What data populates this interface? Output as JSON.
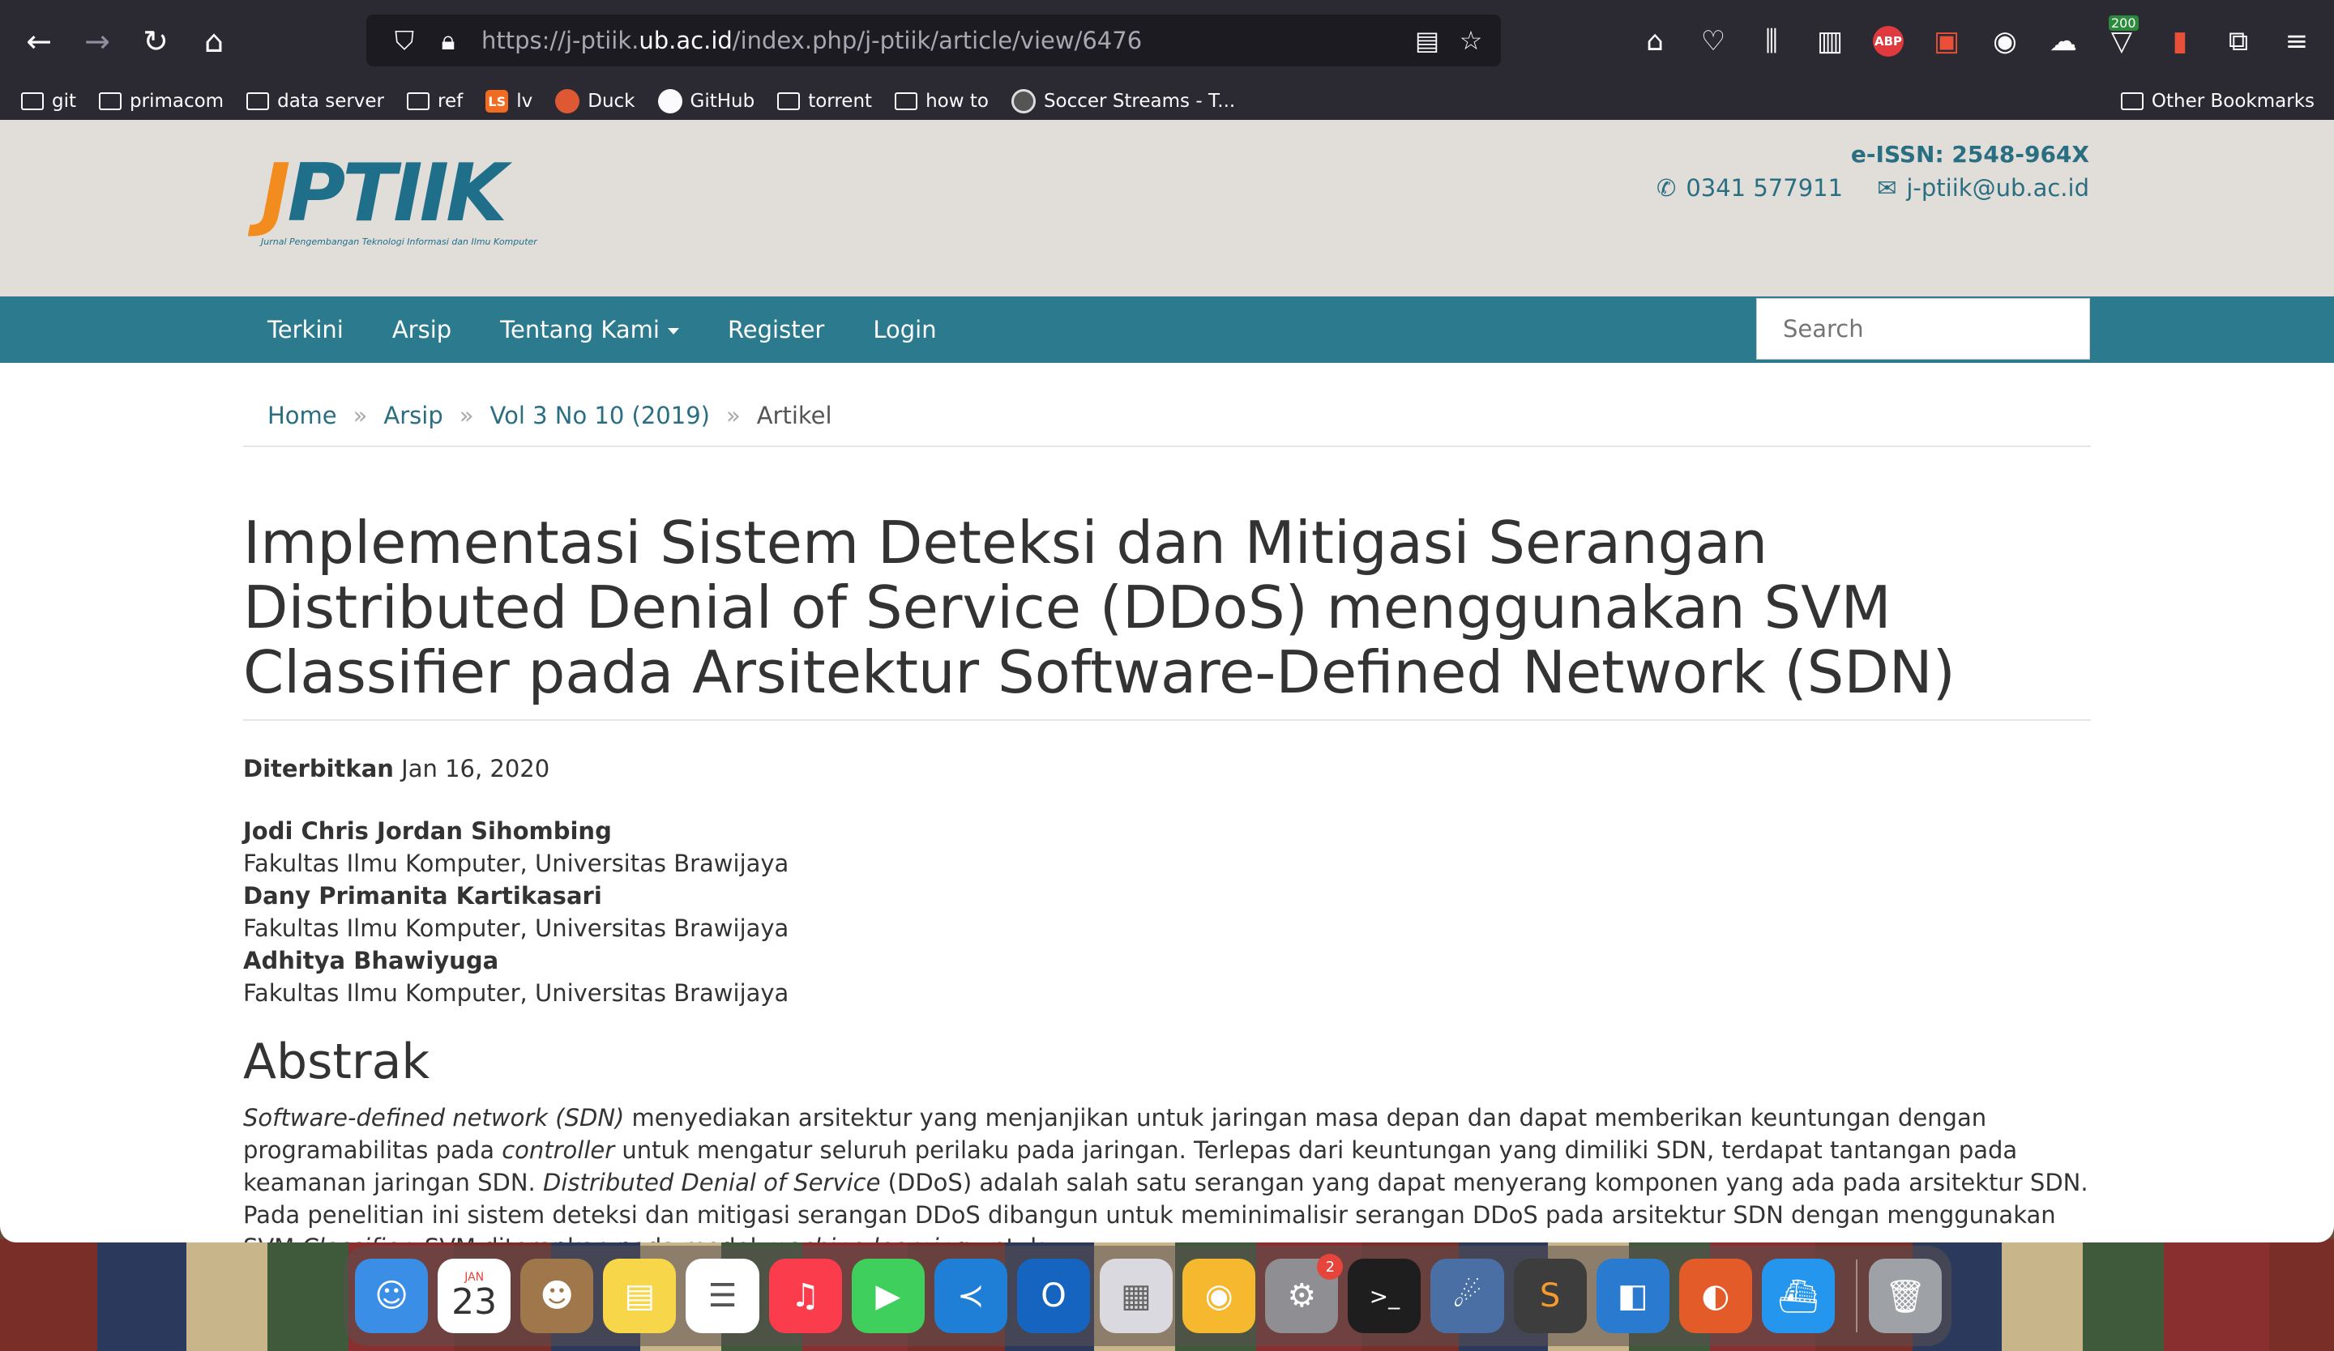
{
  "browser": {
    "url_prefix": "https://j-ptiik.",
    "url_domain": "ub.ac.id",
    "url_path": "/index.php/j-ptiik/article/view/6476",
    "ext_badge": "200"
  },
  "bookmarks": {
    "items": [
      {
        "label": "git",
        "kind": "folder"
      },
      {
        "label": "primacom",
        "kind": "folder"
      },
      {
        "label": "data server",
        "kind": "folder"
      },
      {
        "label": "ref",
        "kind": "folder"
      },
      {
        "label": "lv",
        "kind": "lv"
      },
      {
        "label": "Duck",
        "kind": "duck"
      },
      {
        "label": "GitHub",
        "kind": "github"
      },
      {
        "label": "torrent",
        "kind": "folder"
      },
      {
        "label": "how to",
        "kind": "folder"
      },
      {
        "label": "Soccer Streams - T...",
        "kind": "ball"
      }
    ],
    "other": "Other Bookmarks"
  },
  "site": {
    "logo_main_j": "J",
    "logo_main_rest": "PTIIK",
    "logo_sub": "Jurnal Pengembangan Teknologi Informasi dan Ilmu Komputer",
    "issn": "e-ISSN: 2548-964X",
    "phone": "0341 577911",
    "email": "j-ptiik@ub.ac.id"
  },
  "nav": {
    "items": [
      "Terkini",
      "Arsip",
      "Tentang Kami",
      "Register",
      "Login"
    ],
    "search_placeholder": "Search"
  },
  "breadcrumb": {
    "home": "Home",
    "arsip": "Arsip",
    "issue": "Vol 3 No 10 (2019)",
    "current": "Artikel",
    "sep": "»"
  },
  "article": {
    "title": "Implementasi Sistem Deteksi dan Mitigasi Serangan Distributed Denial of Service (DDoS) menggunakan SVM Classifier pada Arsitektur Software-Defined Network (SDN)",
    "published_label": "Diterbitkan",
    "published_date": "Jan 16, 2020",
    "authors": [
      {
        "name": "Jodi Chris Jordan Sihombing",
        "affiliation": "Fakultas Ilmu Komputer, Universitas Brawijaya"
      },
      {
        "name": "Dany Primanita Kartikasari",
        "affiliation": "Fakultas Ilmu Komputer, Universitas Brawijaya"
      },
      {
        "name": "Adhitya Bhawiyuga",
        "affiliation": "Fakultas Ilmu Komputer, Universitas Brawijaya"
      }
    ],
    "abstract_heading": "Abstrak",
    "abstract": {
      "p1_i1": "Software-defined network (SDN)",
      "p1_t1": " menyediakan arsitektur yang menjanjikan untuk jaringan masa depan dan dapat memberikan keuntungan dengan programabilitas pada ",
      "p1_i2": "controller",
      "p1_t2": " untuk mengatur seluruh perilaku pada jaringan. Terlepas dari keuntungan yang dimiliki SDN, terdapat tantangan pada keamanan jaringan SDN. ",
      "p1_i3": "Distributed Denial of Service",
      "p1_t3": " (DDoS) adalah salah satu serangan yang dapat menyerang komponen yang ada pada arsitektur SDN. Pada penelitian ini sistem deteksi dan mitigasi serangan DDoS dibangun untuk meminimalisir serangan DDoS pada arsitektur SDN dengan menggunakan SVM ",
      "p1_i4": "Classifier",
      "p1_t4": ". SVM diterapkan pada model ",
      "p1_i5": "machine learning",
      "p1_t5": " untuk"
    }
  },
  "dock": {
    "calendar_month": "JAN",
    "calendar_day": "23",
    "settings_badge": "2",
    "colors": {
      "finder": "#3a8ee6",
      "calendar": "#ffffff",
      "contacts": "#a0774a",
      "notes": "#f7d64a",
      "reminders": "#ffffff",
      "music": "#fa3c4c",
      "facetime": "#3ecf5c",
      "vscode": "#1f7ed6",
      "outlook": "#1565c0",
      "launchpad": "#d9d9df",
      "podcast": "#f5b82e",
      "settings": "#8e8e93",
      "terminal": "#1e1e1e",
      "gimp": "#4a6fa5",
      "sublime": "#3d3d3d",
      "vmware": "#2a7bd0",
      "firefox": "#e45b2a",
      "docker": "#2496ed",
      "trash": "#9ea1a6"
    }
  }
}
